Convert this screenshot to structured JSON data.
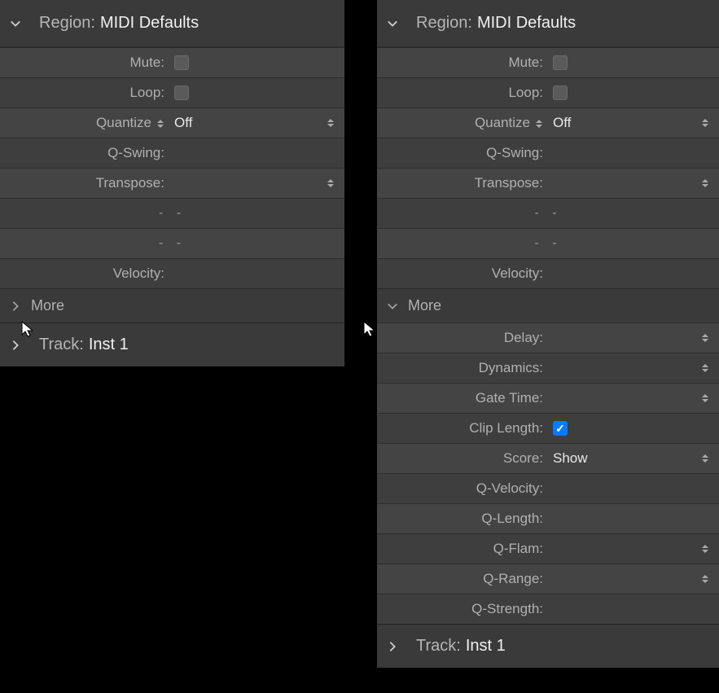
{
  "left": {
    "header": {
      "label": "Region:",
      "value": "MIDI Defaults"
    },
    "rows": {
      "mute": "Mute:",
      "loop": "Loop:",
      "quantize": "Quantize",
      "quantize_value": "Off",
      "qswing": "Q-Swing:",
      "transpose": "Transpose:",
      "dash1": "-  -",
      "dash2": "-  -",
      "velocity": "Velocity:"
    },
    "more_label": "More",
    "track": {
      "label": "Track:",
      "value": "Inst 1"
    }
  },
  "right": {
    "header": {
      "label": "Region:",
      "value": "MIDI Defaults"
    },
    "rows": {
      "mute": "Mute:",
      "loop": "Loop:",
      "quantize": "Quantize",
      "quantize_value": "Off",
      "qswing": "Q-Swing:",
      "transpose": "Transpose:",
      "dash1": "-  -",
      "dash2": "-  -",
      "velocity": "Velocity:"
    },
    "more_label": "More",
    "more": {
      "delay": "Delay:",
      "dynamics": "Dynamics:",
      "gate_time": "Gate Time:",
      "clip_length": "Clip Length:",
      "score": "Score:",
      "score_value": "Show",
      "qvelocity": "Q-Velocity:",
      "qlength": "Q-Length:",
      "qflam": "Q-Flam:",
      "qrange": "Q-Range:",
      "qstrength": "Q-Strength:"
    },
    "track": {
      "label": "Track:",
      "value": "Inst 1"
    }
  }
}
